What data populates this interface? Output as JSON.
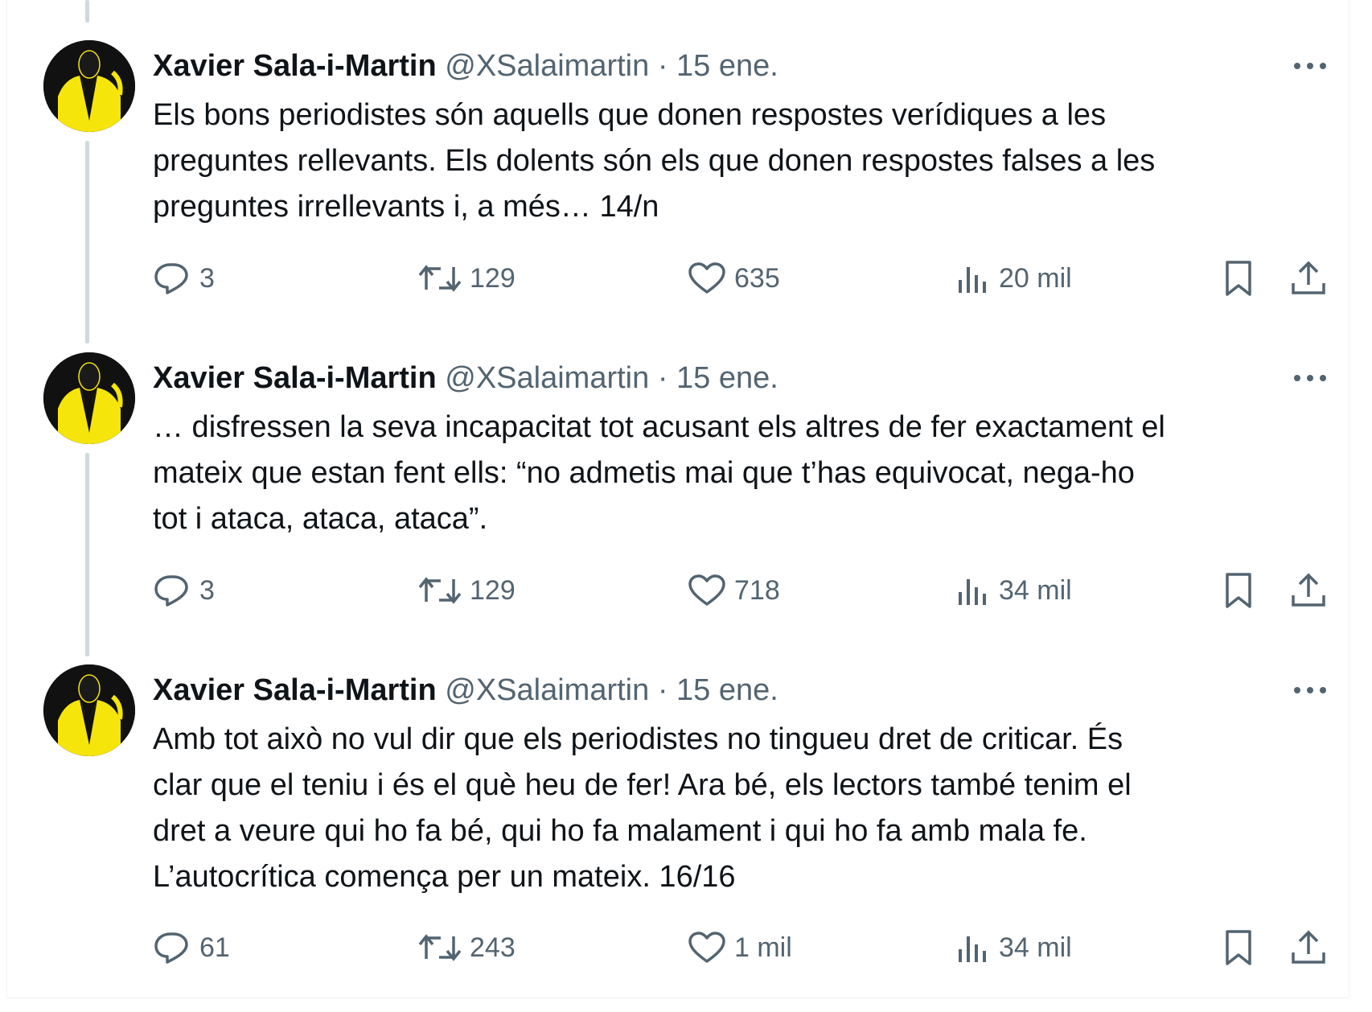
{
  "colors": {
    "text": "#0f1419",
    "secondary": "#536471",
    "thread_line": "#cfd9de",
    "avatar_yellow": "#f5e50a"
  },
  "tweets": [
    {
      "author_name": "Xavier Sala-i-Martin",
      "handle": "@XSalaimartin",
      "separator": "·",
      "date": "15 ene.",
      "text_lines": [
        "Els bons periodistes són aquells que donen respostes verídiques a les",
        "preguntes rellevants. Els dolents són els que donen respostes falses a les",
        "preguntes irrellevants i, a més… 14/n"
      ],
      "replies": "3",
      "retweets": "129",
      "likes": "635",
      "views": "20 mil"
    },
    {
      "author_name": "Xavier Sala-i-Martin",
      "handle": "@XSalaimartin",
      "separator": "·",
      "date": "15 ene.",
      "text_lines": [
        "… disfressen la seva incapacitat tot acusant els altres de fer exactament el",
        "mateix que estan fent ells: “no admetis mai que t’has equivocat, nega-ho",
        "tot i ataca, ataca, ataca”."
      ],
      "replies": "3",
      "retweets": "129",
      "likes": "718",
      "views": "34 mil"
    },
    {
      "author_name": "Xavier Sala-i-Martin",
      "handle": "@XSalaimartin",
      "separator": "·",
      "date": "15 ene.",
      "text_lines": [
        "Amb  tot això no vul dir que els periodistes no tingueu dret de criticar. És",
        "clar que el teniu i és el què heu de fer! Ara bé, els lectors també tenim el",
        "dret a veure qui ho fa bé, qui ho fa malament i qui ho fa amb mala fe.",
        "L’autocrítica comença per un mateix. 16/16"
      ],
      "replies": "61",
      "retweets": "243",
      "likes": "1 mil",
      "views": "34 mil"
    }
  ],
  "icons": {
    "reply": "reply-icon",
    "retweet": "retweet-icon",
    "like": "heart-icon",
    "views": "views-icon",
    "bookmark": "bookmark-icon",
    "share": "share-icon",
    "more": "more-icon"
  }
}
